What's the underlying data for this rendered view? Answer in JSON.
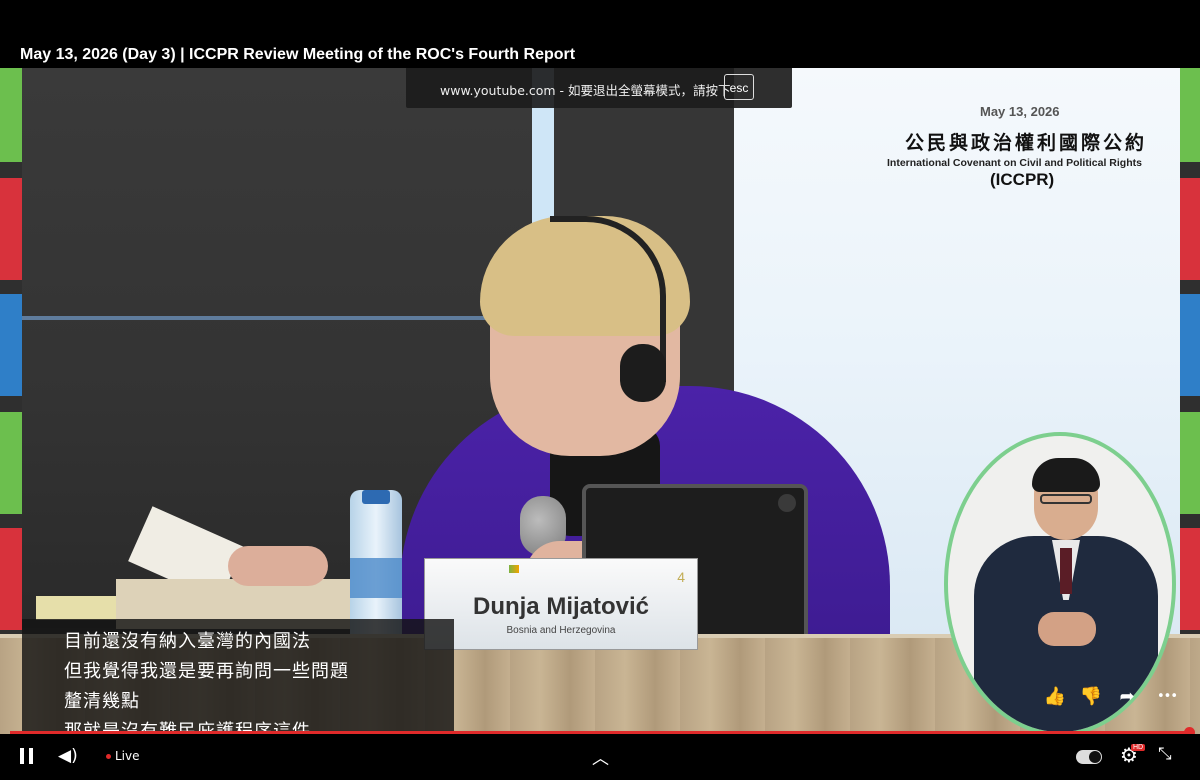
{
  "stream": {
    "title": "May 13, 2026 (Day 3) | ICCPR Review Meeting of the ROC's Fourth Report"
  },
  "fullscreen_notice": {
    "message": "www.youtube.com - 如要退出全螢幕模式，請按下",
    "key_label": "esc"
  },
  "backdrop": {
    "date": "May 13, 2026",
    "title_zh": "公民與政治權利國際公約",
    "title_en": "International Covenant on Civil and Political Rights",
    "abbr": "(ICCPR)",
    "stripe_colors": [
      "#6cbf4e",
      "#d8323c",
      "#2f7fc8"
    ]
  },
  "nameplate": {
    "number": "4",
    "name": "Dunja Mijatović",
    "country": "Bosnia and Herzegovina"
  },
  "subtitles": [
    "目前還沒有納入臺灣的內國法",
    "但我覺得我還是要再詢問一些問題",
    "釐清幾點",
    "那就是沒有難民庇護程序這件"
  ],
  "actions": {
    "like_icon": "👍",
    "dislike_icon": "👎",
    "share_icon": "➦",
    "more_icon": "•••"
  },
  "player": {
    "live_label": "Live",
    "hd_badge": "HD",
    "progress_fraction": 1.0,
    "accent_color": "#e02a2a"
  }
}
